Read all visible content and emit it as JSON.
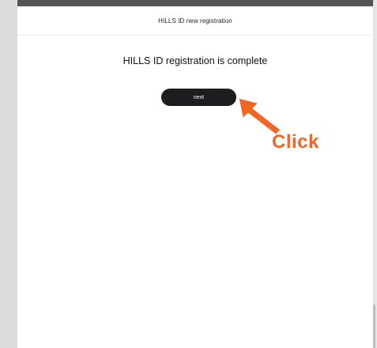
{
  "header": {
    "title": "HILLS ID new registration"
  },
  "main": {
    "message": "HILLS ID registration is complete",
    "next_button_label": "next"
  },
  "annotation": {
    "label": "Click",
    "color": "#f26522",
    "icon": "arrow-pointer-icon"
  },
  "colors": {
    "button_bg": "#1d1d1f",
    "top_bar": "#555555"
  }
}
